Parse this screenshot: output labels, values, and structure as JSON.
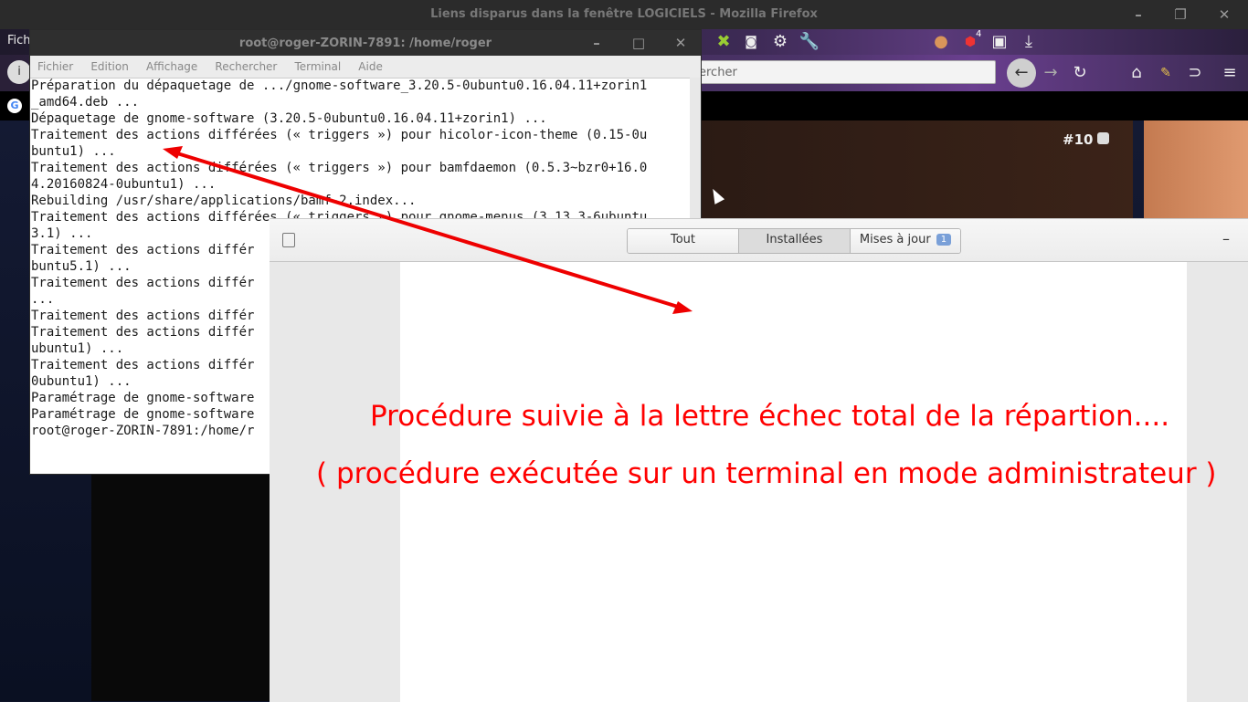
{
  "firefox": {
    "window_title": "Liens disparus dans la fenêtre LOGICIELS - Mozilla Firefox",
    "menubar_first": "Fich",
    "search_placeholder": "ercher",
    "card_number": "#10",
    "abp_count": "4",
    "icons": [
      "info-icon",
      "tools-icon",
      "screenshot-icon",
      "gear-icon",
      "wrench-icon",
      "cookie-icon",
      "adblock-icon",
      "save-icon",
      "download-icon",
      "back-icon",
      "forward-icon",
      "reload-icon",
      "home-icon",
      "pencil-icon",
      "sync-icon",
      "menu-icon",
      "google-icon"
    ]
  },
  "terminal": {
    "title": "root@roger-ZORIN-7891: /home/roger",
    "menu": [
      "Fichier",
      "Edition",
      "Affichage",
      "Rechercher",
      "Terminal",
      "Aide"
    ],
    "lines": [
      "Préparation du dépaquetage de .../gnome-software_3.20.5-0ubuntu0.16.04.11+zorin1",
      "_amd64.deb ...",
      "Dépaquetage de gnome-software (3.20.5-0ubuntu0.16.04.11+zorin1) ...",
      "Traitement des actions différées (« triggers ») pour hicolor-icon-theme (0.15-0u",
      "buntu1) ...",
      "Traitement des actions différées (« triggers ») pour bamfdaemon (0.5.3~bzr0+16.0",
      "4.20160824-0ubuntu1) ...",
      "Rebuilding /usr/share/applications/bamf-2.index...",
      "Traitement des actions différées (« triggers ») pour gnome-menus (3.13.3-6ubuntu",
      "3.1) ...",
      "Traitement des actions différ",
      "buntu5.1) ...",
      "Traitement des actions différ",
      "...",
      "Traitement des actions différ",
      "Traitement des actions différ",
      "ubuntu1) ...",
      "Traitement des actions différ",
      "0ubuntu1) ...",
      "Paramétrage de gnome-software",
      "Paramétrage de gnome-software",
      "root@roger-ZORIN-7891:/home/r"
    ]
  },
  "software": {
    "tabs": [
      "Tout",
      "Installées",
      "Mises à jour"
    ],
    "updates_badge": "1",
    "minimize": "–"
  },
  "annotation": {
    "line1": "Procédure suivie à la lettre échec total de la répartion....",
    "line2": "( procédure exécutée sur un terminal en mode administrateur )",
    "color": "#ff0000"
  }
}
